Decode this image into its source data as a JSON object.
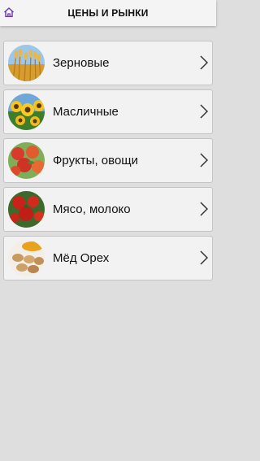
{
  "header": {
    "title": "ЦЕНЫ И РЫНКИ",
    "home_icon": "home-icon",
    "accent": "#6a35b8"
  },
  "categories": [
    {
      "label": "Зерновые",
      "icon": "wheat-icon"
    },
    {
      "label": "Масличные",
      "icon": "sunflower-icon"
    },
    {
      "label": "Фрукты, овощи",
      "icon": "apples-icon"
    },
    {
      "label": "Мясо, молоко",
      "icon": "tomatoes-icon"
    },
    {
      "label": "Мёд Орех",
      "icon": "honey-nuts-icon"
    }
  ]
}
